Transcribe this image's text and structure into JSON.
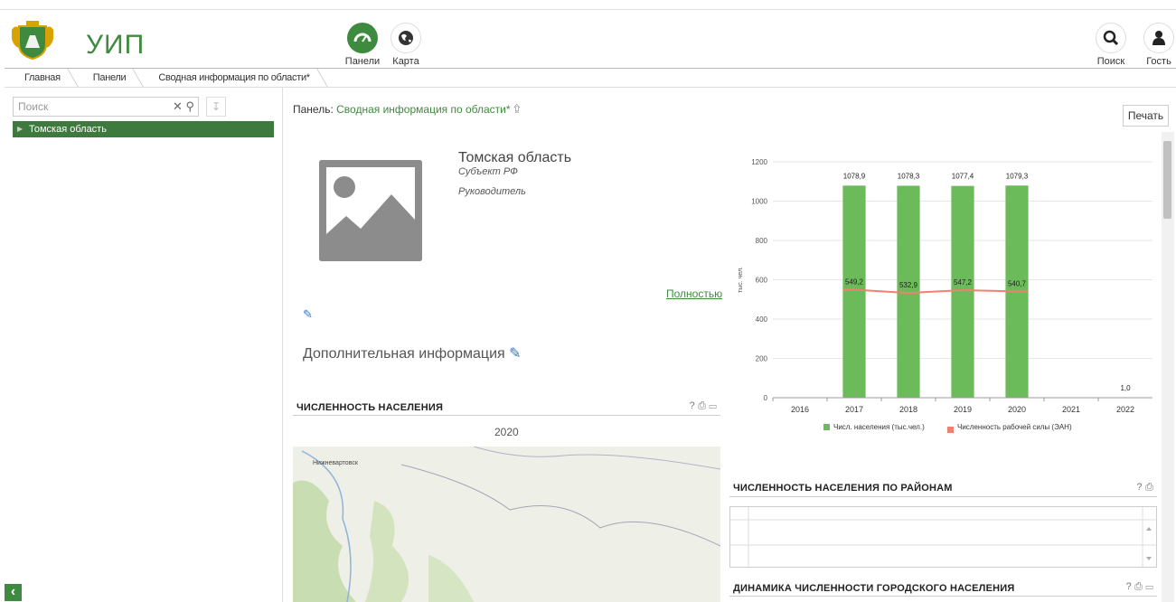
{
  "app": {
    "title": "УИП"
  },
  "nav": [
    {
      "label": "Панели",
      "icon": "dashboard-icon"
    },
    {
      "label": "Карта",
      "icon": "globe-icon"
    }
  ],
  "right_nav": [
    {
      "label": "Поиск",
      "icon": "search-icon"
    },
    {
      "label": "Гость",
      "icon": "user-icon"
    }
  ],
  "breadcrumb": [
    "Главная",
    "Панели",
    "Сводная информация по области*"
  ],
  "sidebar": {
    "search_placeholder": "Поиск",
    "tree": [
      {
        "label": "Томская область"
      }
    ]
  },
  "panel": {
    "prefix": "Панель:",
    "name": "Сводная информация по области*",
    "print_label": "Печать"
  },
  "entity": {
    "name": "Томская область",
    "type": "Субъект РФ",
    "head": "Руководитель",
    "full_link": "Полностью",
    "extra_info": "Дополнительная информация"
  },
  "widgets": {
    "population": {
      "title": "ЧИСЛЕННОСТЬ НАСЕЛЕНИЯ",
      "year": "2020",
      "map_city": "Нижневартовск"
    },
    "districts": {
      "title": "ЧИСЛЕННОСТЬ НАСЕЛЕНИЯ ПО РАЙОНАМ"
    },
    "urban": {
      "title": "ДИНАМИКА ЧИСЛЕННОСТИ ГОРОДСКОГО НАСЕЛЕНИЯ"
    },
    "tools_full": "? ⎙ ▭",
    "tools_short": "? ⎙"
  },
  "chart_data": {
    "type": "bar",
    "categories": [
      "2016",
      "2017",
      "2018",
      "2019",
      "2020",
      "2021",
      "2022"
    ],
    "ylabel": "тыс. чел.",
    "ylim": [
      0,
      1200
    ],
    "yticks": [
      0,
      200,
      400,
      600,
      800,
      1000,
      1200
    ],
    "series": [
      {
        "name": "Числ. населения (тыс.чел.)",
        "type": "bar",
        "color": "#6cbb5a",
        "values": [
          null,
          1078.9,
          1078.3,
          1077.4,
          1079.3,
          null,
          1.0
        ],
        "labels": [
          "",
          "1078,9",
          "1078,3",
          "1077,4",
          "1079,3",
          "",
          "1,0"
        ]
      },
      {
        "name": "Численность рабочей силы (ЭАН)",
        "type": "line",
        "color": "#f08070",
        "values": [
          null,
          549.2,
          532.9,
          547.2,
          540.7,
          null,
          null
        ],
        "labels": [
          "",
          "549,2",
          "532,9",
          "547,2",
          "540,7",
          "",
          ""
        ]
      }
    ],
    "legend_position": "bottom"
  }
}
